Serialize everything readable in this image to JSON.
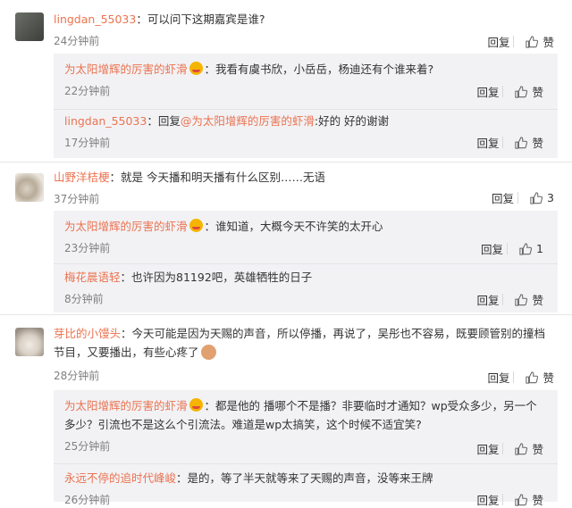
{
  "actions": {
    "reply": "回复",
    "like": "赞"
  },
  "threads": [
    {
      "user": "lingdan_55033",
      "text": "：可以问下这期嘉宾是谁?",
      "time": "24分钟前",
      "likes": "赞",
      "replies": [
        {
          "user": "为太阳增辉的厉害的虾滑",
          "text": "：我看有虞书欣，小岳岳，杨迪还有个谁来着?",
          "time": "22分钟前",
          "likes": "赞"
        },
        {
          "user": "lingdan_55033",
          "text_pre": "：回复",
          "mention": "@为太阳增辉的厉害的虾滑",
          "text": ":好的 好的谢谢",
          "time": "17分钟前",
          "likes": "赞"
        }
      ]
    },
    {
      "user": "山野洋桔梗",
      "text": "：就是 今天播和明天播有什么区别……无语",
      "time": "37分钟前",
      "likes": "3",
      "replies": [
        {
          "user": "为太阳增辉的厉害的虾滑",
          "text": "：谁知道，大概今天不许笑的太开心",
          "time": "23分钟前",
          "likes": "1"
        },
        {
          "user": "梅花晨语轻",
          "text": "：也许因为81192吧，英雄牺牲的日子",
          "time": "8分钟前",
          "likes": "赞"
        }
      ]
    },
    {
      "user": "芽比的小馒头",
      "text": "：今天可能是因为天赐的声音，所以停播，再说了，吴彤也不容易，既要顾管别的撞档节目，又要播出，有些心疼了",
      "time": "28分钟前",
      "likes": "赞",
      "replies": [
        {
          "user": "为太阳增辉的厉害的虾滑",
          "text": "：都是他的 播哪个不是播？非要临时才通知？wp受众多少，另一个多少？引流也不是这么个引流法。难道是wp太搞笑，这个时候不适宜笑?",
          "time": "25分钟前",
          "likes": "赞"
        },
        {
          "user": "永远不停的追时代峰峻",
          "text": "：是的，等了半天就等来了天赐的声音，没等来王牌",
          "time": "26分钟前",
          "likes": "赞"
        }
      ]
    }
  ]
}
